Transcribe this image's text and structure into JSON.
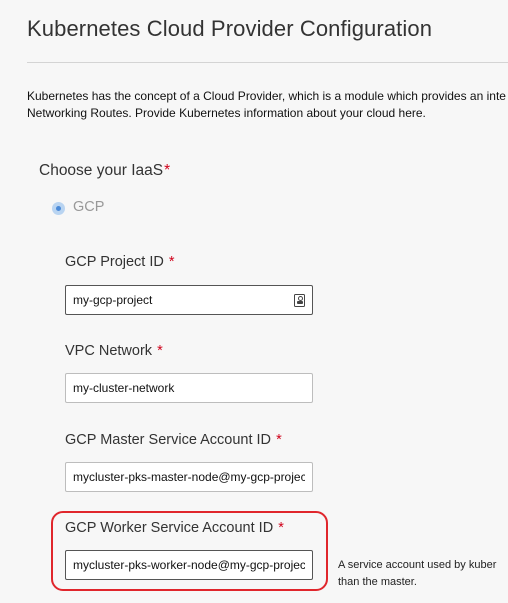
{
  "page": {
    "title": "Kubernetes Cloud Provider Configuration",
    "description_line1": "Kubernetes has the concept of a Cloud Provider, which is a module which provides an inte",
    "description_line2": "Networking Routes. Provide Kubernetes information about your cloud here."
  },
  "iaas": {
    "label": "Choose your IaaS",
    "required_marker": "*",
    "selected_option": "GCP"
  },
  "fields": {
    "project_id": {
      "label": "GCP Project ID",
      "required_marker": "*",
      "value": "my-gcp-project",
      "icon": "password-manager-icon"
    },
    "vpc_network": {
      "label": "VPC Network",
      "required_marker": "*",
      "value": "my-cluster-network"
    },
    "master_sa": {
      "label": "GCP Master Service Account ID",
      "required_marker": "*",
      "value": "mycluster-pks-master-node@my-gcp-project"
    },
    "worker_sa": {
      "label": "GCP Worker Service Account ID",
      "required_marker": "*",
      "value": "mycluster-pks-worker-node@my-gcp-project",
      "help_line1": "A service account used by kuber",
      "help_line2": "than the master."
    }
  },
  "colors": {
    "required": "#d0021b",
    "highlight": "#e0262c",
    "radio": "#4a8ad8"
  }
}
